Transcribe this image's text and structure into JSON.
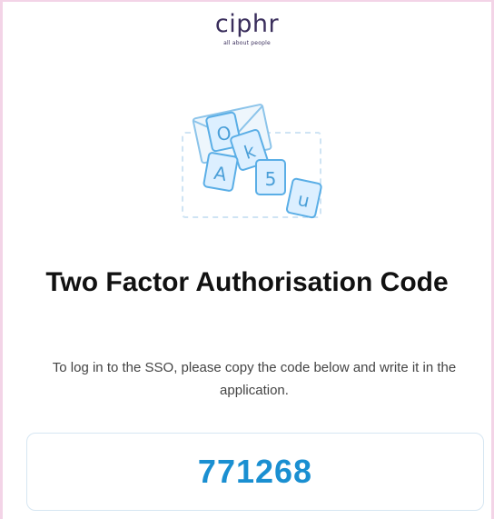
{
  "brand": {
    "name": "ciphr",
    "tagline": "all about people"
  },
  "illustration": {
    "icon": "envelope-letter-tiles-icon",
    "tiles": [
      "O",
      "k",
      "A",
      "5",
      "u"
    ],
    "colors": {
      "stroke": "#6fb6e6",
      "fill": "#e6f3fc",
      "dash": "#cfe4f4"
    }
  },
  "title": "Two Factor Authorisation Code",
  "instructions": "To log in to the SSO, please copy the code below and write it in the application.",
  "code": "771268",
  "colors": {
    "code": "#1a8fd1",
    "border": "#f3d4e7",
    "title": "#111111"
  }
}
